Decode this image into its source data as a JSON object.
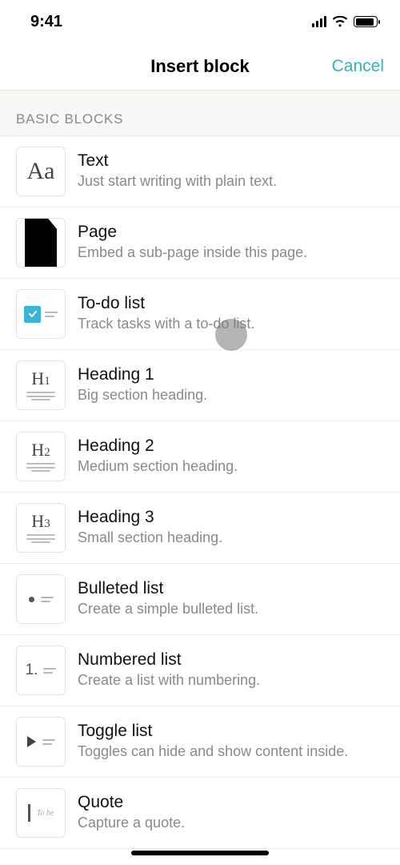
{
  "status": {
    "time": "9:41"
  },
  "header": {
    "title": "Insert block",
    "cancel": "Cancel"
  },
  "section": {
    "basic": "BASIC BLOCKS"
  },
  "blocks": [
    {
      "title": "Text",
      "desc": "Just start writing with plain text."
    },
    {
      "title": "Page",
      "desc": "Embed a sub-page inside this page."
    },
    {
      "title": "To-do list",
      "desc": "Track tasks with a to-do list."
    },
    {
      "title": "Heading 1",
      "desc": "Big section heading."
    },
    {
      "title": "Heading 2",
      "desc": "Medium section heading."
    },
    {
      "title": "Heading 3",
      "desc": "Small section heading."
    },
    {
      "title": "Bulleted list",
      "desc": "Create a simple bulleted list."
    },
    {
      "title": "Numbered list",
      "desc": "Create a list with numbering."
    },
    {
      "title": "Toggle list",
      "desc": "Toggles can hide and show content inside."
    },
    {
      "title": "Quote",
      "desc": "Capture a quote."
    }
  ]
}
